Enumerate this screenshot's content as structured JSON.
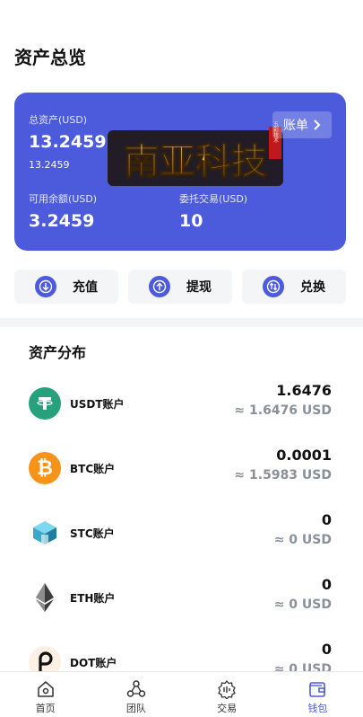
{
  "page": {
    "title": "资产总览"
  },
  "card": {
    "total_label": "总资产(USD)",
    "total_value": "13.2459",
    "total_sub": "13.2459",
    "available_label": "可用余额(USD)",
    "available_value": "3.2459",
    "order_label": "委托交易(USD)",
    "order_value": "10",
    "bill_label": "账单",
    "logo_text": "南亚科技",
    "logo_seal": "五彩技术",
    "color": "#4b5bdc"
  },
  "actions": [
    {
      "label": "充值",
      "icon": "deposit-icon"
    },
    {
      "label": "提现",
      "icon": "withdraw-icon"
    },
    {
      "label": "兑换",
      "icon": "exchange-icon"
    }
  ],
  "distribution": {
    "title": "资产分布",
    "items": [
      {
        "name": "USDT账户",
        "amount": "1.6476",
        "usd": "≈ 1.6476 USD",
        "icon": "usdt-icon",
        "color": "#26a17b"
      },
      {
        "name": "BTC账户",
        "amount": "0.0001",
        "usd": "≈ 1.5983 USD",
        "icon": "btc-icon",
        "color": "#f7931a"
      },
      {
        "name": "STC账户",
        "amount": "0",
        "usd": "≈ 0 USD",
        "icon": "stc-icon",
        "color": "#3aa8c9"
      },
      {
        "name": "ETH账户",
        "amount": "0",
        "usd": "≈ 0 USD",
        "icon": "eth-icon",
        "color": "#333333"
      },
      {
        "name": "DOT账户",
        "amount": "0",
        "usd": "≈ 0 USD",
        "icon": "dot-icon",
        "color": "#e6007a"
      }
    ]
  },
  "nav": [
    {
      "label": "首页",
      "icon": "home-icon",
      "active": false
    },
    {
      "label": "团队",
      "icon": "team-icon",
      "active": false
    },
    {
      "label": "交易",
      "icon": "trade-icon",
      "active": false
    },
    {
      "label": "钱包",
      "icon": "wallet-icon",
      "active": true
    }
  ]
}
